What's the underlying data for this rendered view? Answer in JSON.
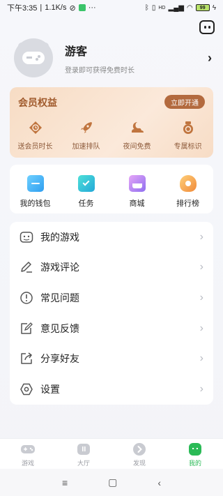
{
  "status_bar": {
    "time": "下午3:35",
    "speed": "1.1K/s",
    "battery": "99",
    "network": "HD"
  },
  "profile": {
    "name": "游客",
    "subtitle": "登录即可获得免费时长"
  },
  "vip": {
    "title": "会员权益",
    "button": "立即开通",
    "items": [
      {
        "label": "送会员时长",
        "icon": "clock-tag-icon"
      },
      {
        "label": "加速排队",
        "icon": "rocket-icon"
      },
      {
        "label": "夜间免费",
        "icon": "moon-cloud-icon"
      },
      {
        "label": "专属标识",
        "icon": "badge-icon"
      }
    ]
  },
  "quick": [
    {
      "label": "我的钱包",
      "icon": "wallet-icon",
      "color": "#3fb4f0"
    },
    {
      "label": "任务",
      "icon": "task-icon",
      "color": "#2fc6d0"
    },
    {
      "label": "商城",
      "icon": "store-icon",
      "color": "#a67cf0"
    },
    {
      "label": "排行榜",
      "icon": "trophy-icon",
      "color": "#f5a34a"
    }
  ],
  "menu": [
    {
      "label": "我的游戏",
      "icon": "gamepad-icon"
    },
    {
      "label": "游戏评论",
      "icon": "pencil-icon"
    },
    {
      "label": "常见问题",
      "icon": "exclamation-icon"
    },
    {
      "label": "意见反馈",
      "icon": "feedback-icon"
    },
    {
      "label": "分享好友",
      "icon": "share-icon"
    },
    {
      "label": "设置",
      "icon": "gear-icon"
    }
  ],
  "tabs": [
    {
      "label": "游戏",
      "icon": "controller-icon"
    },
    {
      "label": "大厅",
      "icon": "hall-icon"
    },
    {
      "label": "发现",
      "icon": "discover-icon"
    },
    {
      "label": "我的",
      "icon": "me-icon",
      "active": true
    }
  ],
  "colors": {
    "accent": "#2aba56",
    "vip_text": "#a05a2c",
    "vip_button": "#b36a3e"
  }
}
